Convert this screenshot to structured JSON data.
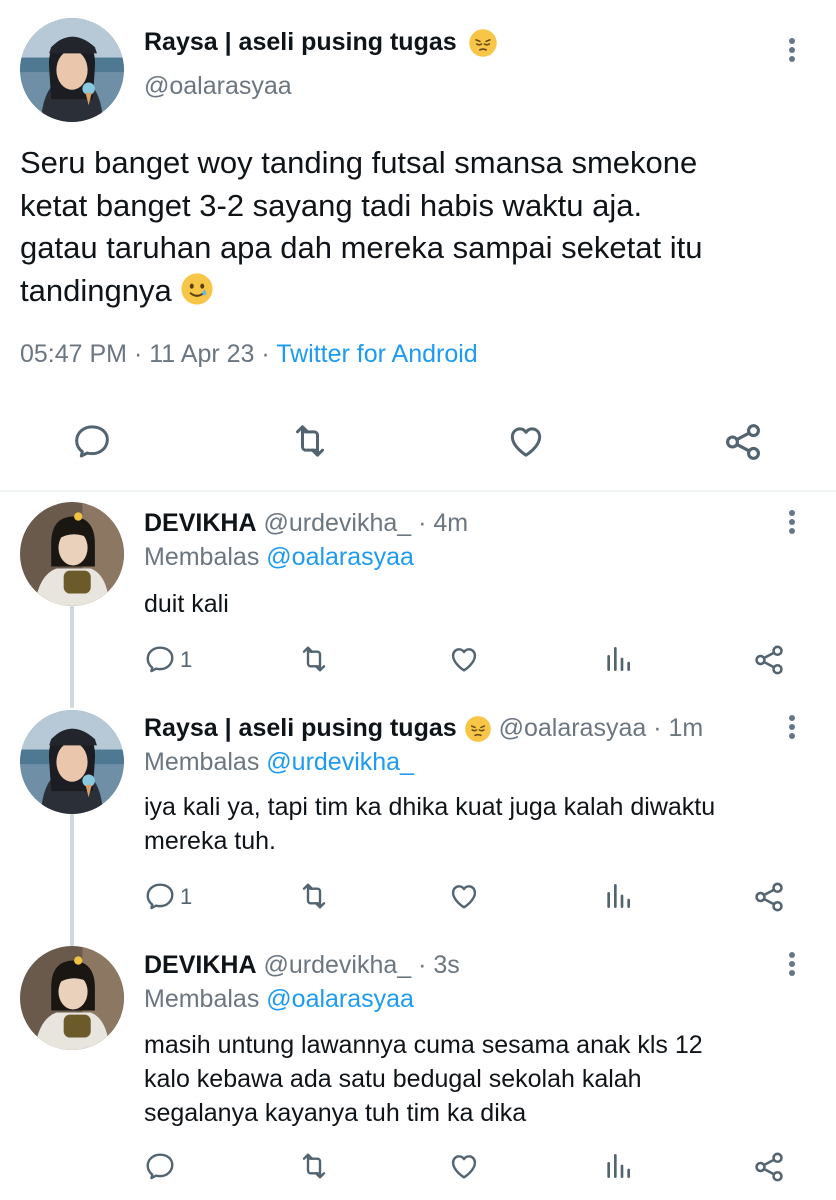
{
  "main_tweet": {
    "display_name": "Raysa | aseli pusing tugas",
    "display_emoji": "pensive-face-emoji",
    "handle": "@oalarasyaa",
    "text_lines": [
      "Seru banget woy tanding futsal smansa smekone",
      "ketat banget 3-2 sayang tadi habis waktu aja.",
      "gatau taruhan apa dah mereka sampai seketat itu",
      "tandingnya"
    ],
    "text_emoji": "smiling-face-with-tear-emoji",
    "time": "05:47 PM",
    "date": "11 Apr 23",
    "separator": "·",
    "source": "Twitter for Android",
    "actions": [
      "reply-icon",
      "retweet-icon",
      "like-icon",
      "share-icon"
    ]
  },
  "replies": [
    {
      "display_name": "DEVIKHA",
      "handle": "@urdevikha_",
      "time_ago": "· 4m",
      "replying_label": "Membalas",
      "replying_to": "@oalarasyaa",
      "text_lines": [
        "duit kali"
      ],
      "reply_count": "1",
      "icons": [
        "reply-icon",
        "retweet-icon",
        "like-icon",
        "analytics-icon",
        "share-icon"
      ]
    },
    {
      "display_name": "Raysa | aseli pusing tugas",
      "display_emoji": "pensive-face-emoji",
      "handle": "@oalarasyaa",
      "time_ago": "· 1m",
      "replying_label": "Membalas",
      "replying_to": "@urdevikha_",
      "text_lines": [
        "iya kali ya, tapi tim ka dhika kuat juga kalah diwaktu",
        "mereka tuh."
      ],
      "reply_count": "1",
      "icons": [
        "reply-icon",
        "retweet-icon",
        "like-icon",
        "analytics-icon",
        "share-icon"
      ]
    },
    {
      "display_name": "DEVIKHA",
      "handle": "@urdevikha_",
      "time_ago": "· 3s",
      "replying_label": "Membalas",
      "replying_to": "@oalarasyaa",
      "text_lines": [
        "masih untung lawannya cuma sesama anak kls 12",
        "kalo kebawa ada satu bedugal sekolah kalah",
        "segalanya kayanya tuh tim ka dika"
      ],
      "reply_count": "",
      "icons": [
        "reply-icon",
        "retweet-icon",
        "like-icon",
        "analytics-icon",
        "share-icon"
      ]
    }
  ],
  "colors": {
    "text": "#0f1419",
    "muted": "#6b7680",
    "link": "#1d9bf0",
    "divider": "#eff3f4",
    "thread_line": "#cfd9de"
  }
}
